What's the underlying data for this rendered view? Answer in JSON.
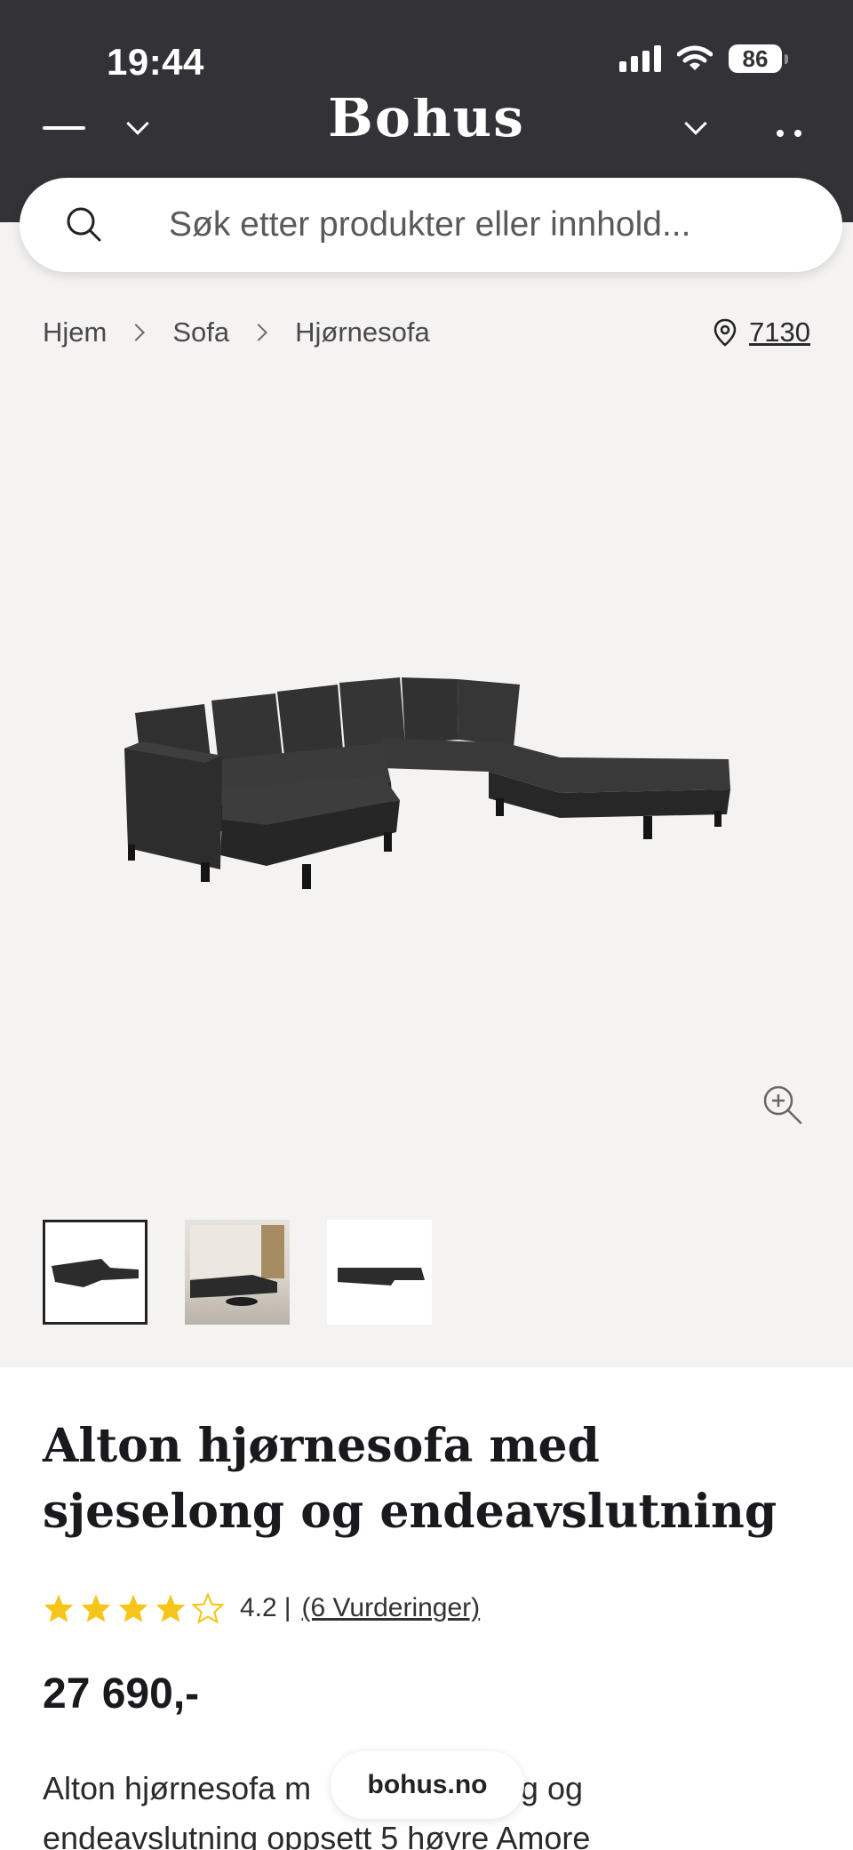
{
  "status_bar": {
    "time": "19:44",
    "battery": "86"
  },
  "header": {
    "brand": "Bohus"
  },
  "search": {
    "placeholder": "Søk etter produkter eller innhold..."
  },
  "breadcrumb": {
    "items": [
      "Hjem",
      "Sofa",
      "Hjørnesofa"
    ],
    "location": "7130"
  },
  "gallery": {
    "thumbnail_count": 3,
    "selected_index": 0
  },
  "product": {
    "title": "Alton hjørnesofa med sjeselong og endeavslutning",
    "rating": {
      "stars": 4,
      "max": 5,
      "value": "4.2",
      "separator": "|",
      "reviews": "(6 Vurderinger)"
    },
    "price": "27 690,-",
    "description_line1": "Alton hjørnesofa m",
    "description_line1_end": "g og",
    "description_line2": "endeavslutning oppsett 5 høyre Amore"
  },
  "browser": {
    "domain": "bohus.no"
  },
  "colors": {
    "header_bg": "#333236",
    "page_bg": "#f4f3f1",
    "star": "#f5c518"
  }
}
